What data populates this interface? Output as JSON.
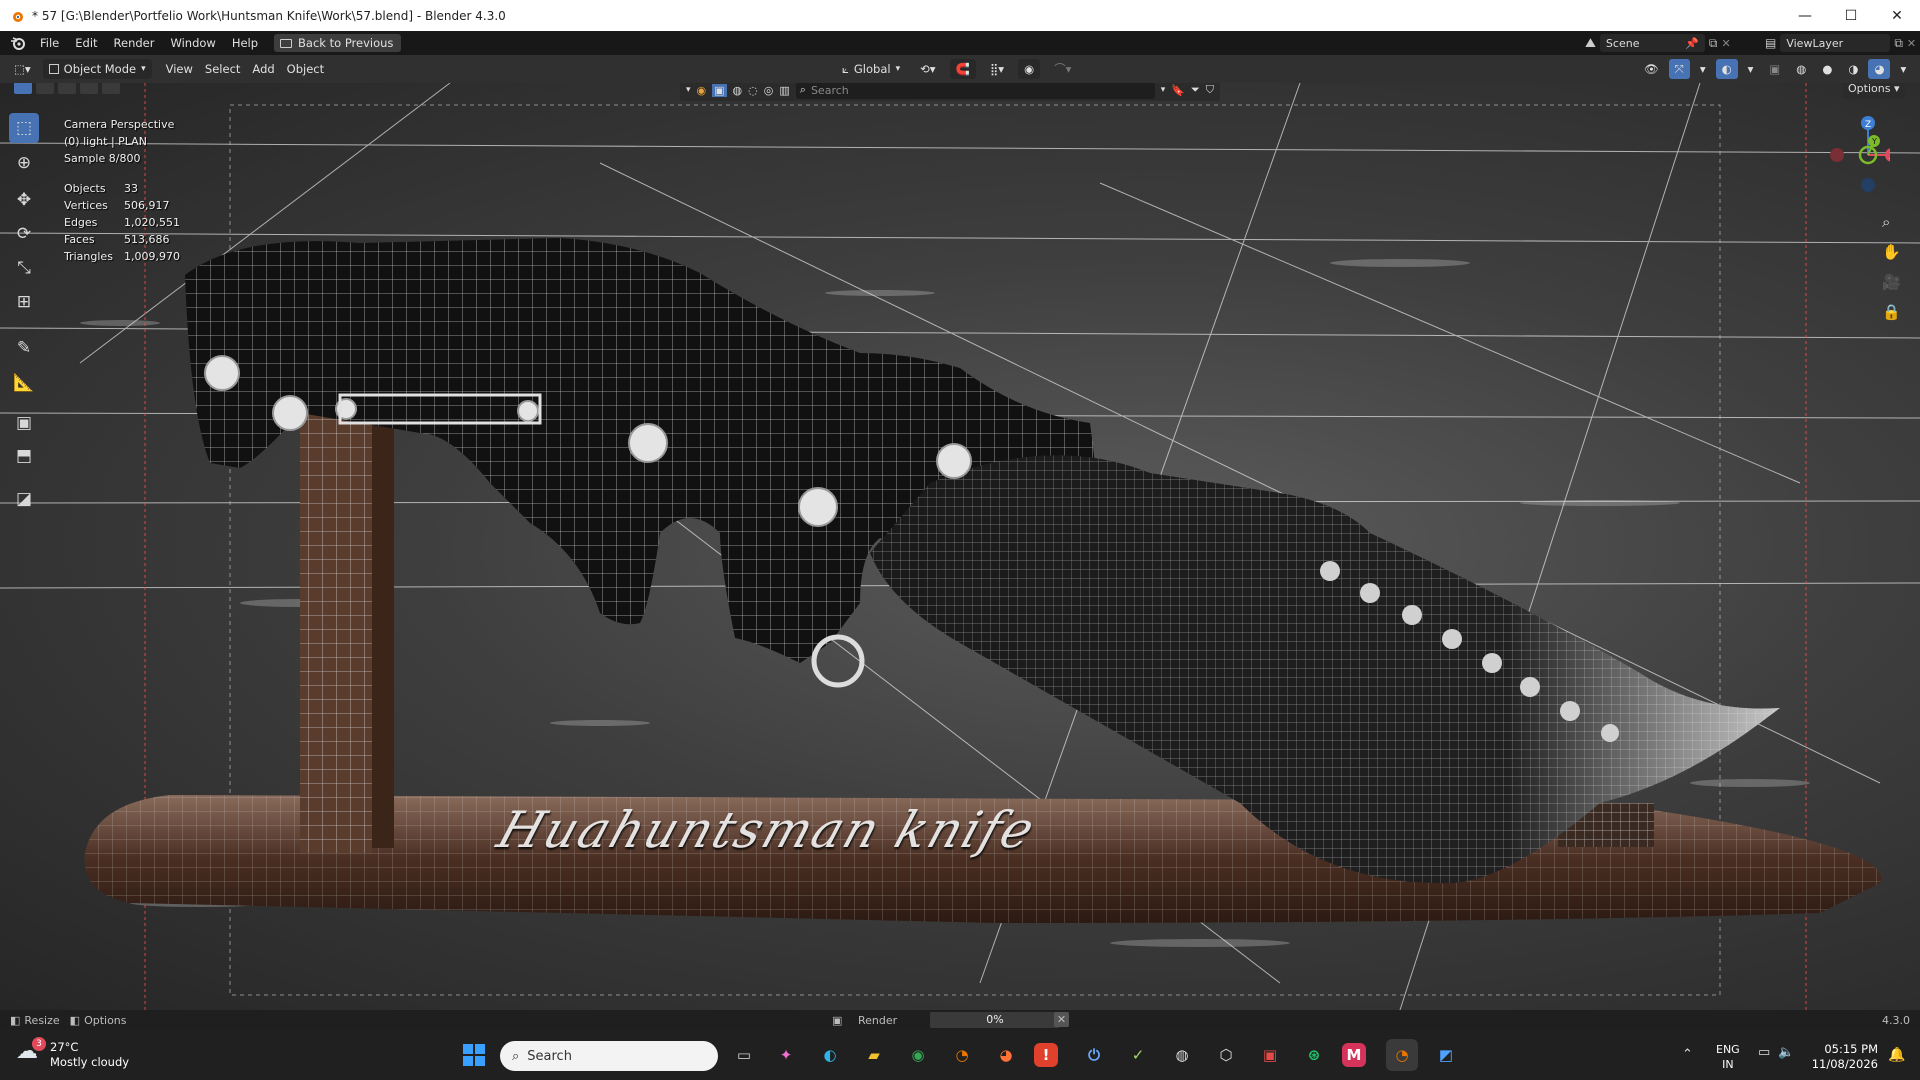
{
  "window": {
    "title": "* 57 [G:\\Blender\\Portfelio Work\\Huntsman Knife\\Work\\57.blend] - Blender 4.3.0",
    "minimize": "—",
    "maximize": "☐",
    "close": "✕"
  },
  "menu": {
    "file": "File",
    "edit": "Edit",
    "render": "Render",
    "window": "Window",
    "help": "Help",
    "back_to_previous": "Back to Previous",
    "scene": "Scene",
    "view_layer": "ViewLayer"
  },
  "viewport_header": {
    "mode": "Object Mode",
    "view": "View",
    "select": "Select",
    "add": "Add",
    "object": "Object",
    "orientation": "Global",
    "search_placeholder": "Search",
    "options": "Options"
  },
  "overlay": {
    "camera": "Camera Perspective",
    "collection": "(0) light |  PLAN",
    "sample": "Sample 8/800",
    "stats": [
      {
        "label": "Objects",
        "value": "33"
      },
      {
        "label": "Vertices",
        "value": "506,917"
      },
      {
        "label": "Edges",
        "value": "1,020,551"
      },
      {
        "label": "Faces",
        "value": "513,686"
      },
      {
        "label": "Triangles",
        "value": "1,009,970"
      }
    ],
    "knife_text": "Huahuntsman knife"
  },
  "gizmo": {
    "z": "Z",
    "y": "Y",
    "x": "X"
  },
  "statusbar": {
    "resize": "Resize",
    "options": "Options",
    "render_label": "Render",
    "progress": "0%",
    "progress_value": 0,
    "version": "4.3.0"
  },
  "taskbar": {
    "weather_badge": "3",
    "temperature": "27°C",
    "weather": "Mostly cloudy",
    "search": "Search",
    "lang_top": "ENG",
    "lang_bottom": "IN",
    "time": "05:15 PM",
    "date": "11/08/2026"
  },
  "colors": {
    "accent": "#4772b3",
    "axis_x": "#e14a5a",
    "axis_y": "#7ebb2a",
    "axis_z": "#3d7fd6"
  }
}
